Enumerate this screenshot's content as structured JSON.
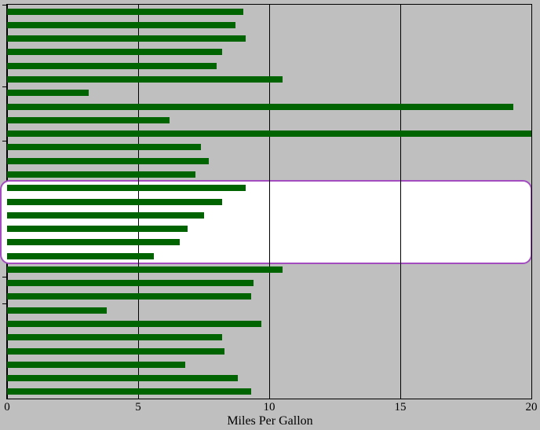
{
  "chart_data": {
    "type": "bar",
    "orientation": "horizontal",
    "xlabel": "Miles Per Gallon",
    "ylabel": "",
    "title": "",
    "xlim": [
      0,
      20
    ],
    "x_ticks": [
      0,
      5,
      10,
      15,
      20
    ],
    "values": [
      9.0,
      8.7,
      9.1,
      8.2,
      8.0,
      10.5,
      3.1,
      19.3,
      6.2,
      21.0,
      7.4,
      7.7,
      7.2,
      9.1,
      8.2,
      7.5,
      6.9,
      6.6,
      5.6,
      10.5,
      9.4,
      9.3,
      3.8,
      9.7,
      8.2,
      8.3,
      6.8,
      8.8,
      9.3
    ],
    "highlight_range": [
      13,
      19
    ],
    "bar_color": "#006400",
    "highlight_color": "#a24cc0"
  }
}
